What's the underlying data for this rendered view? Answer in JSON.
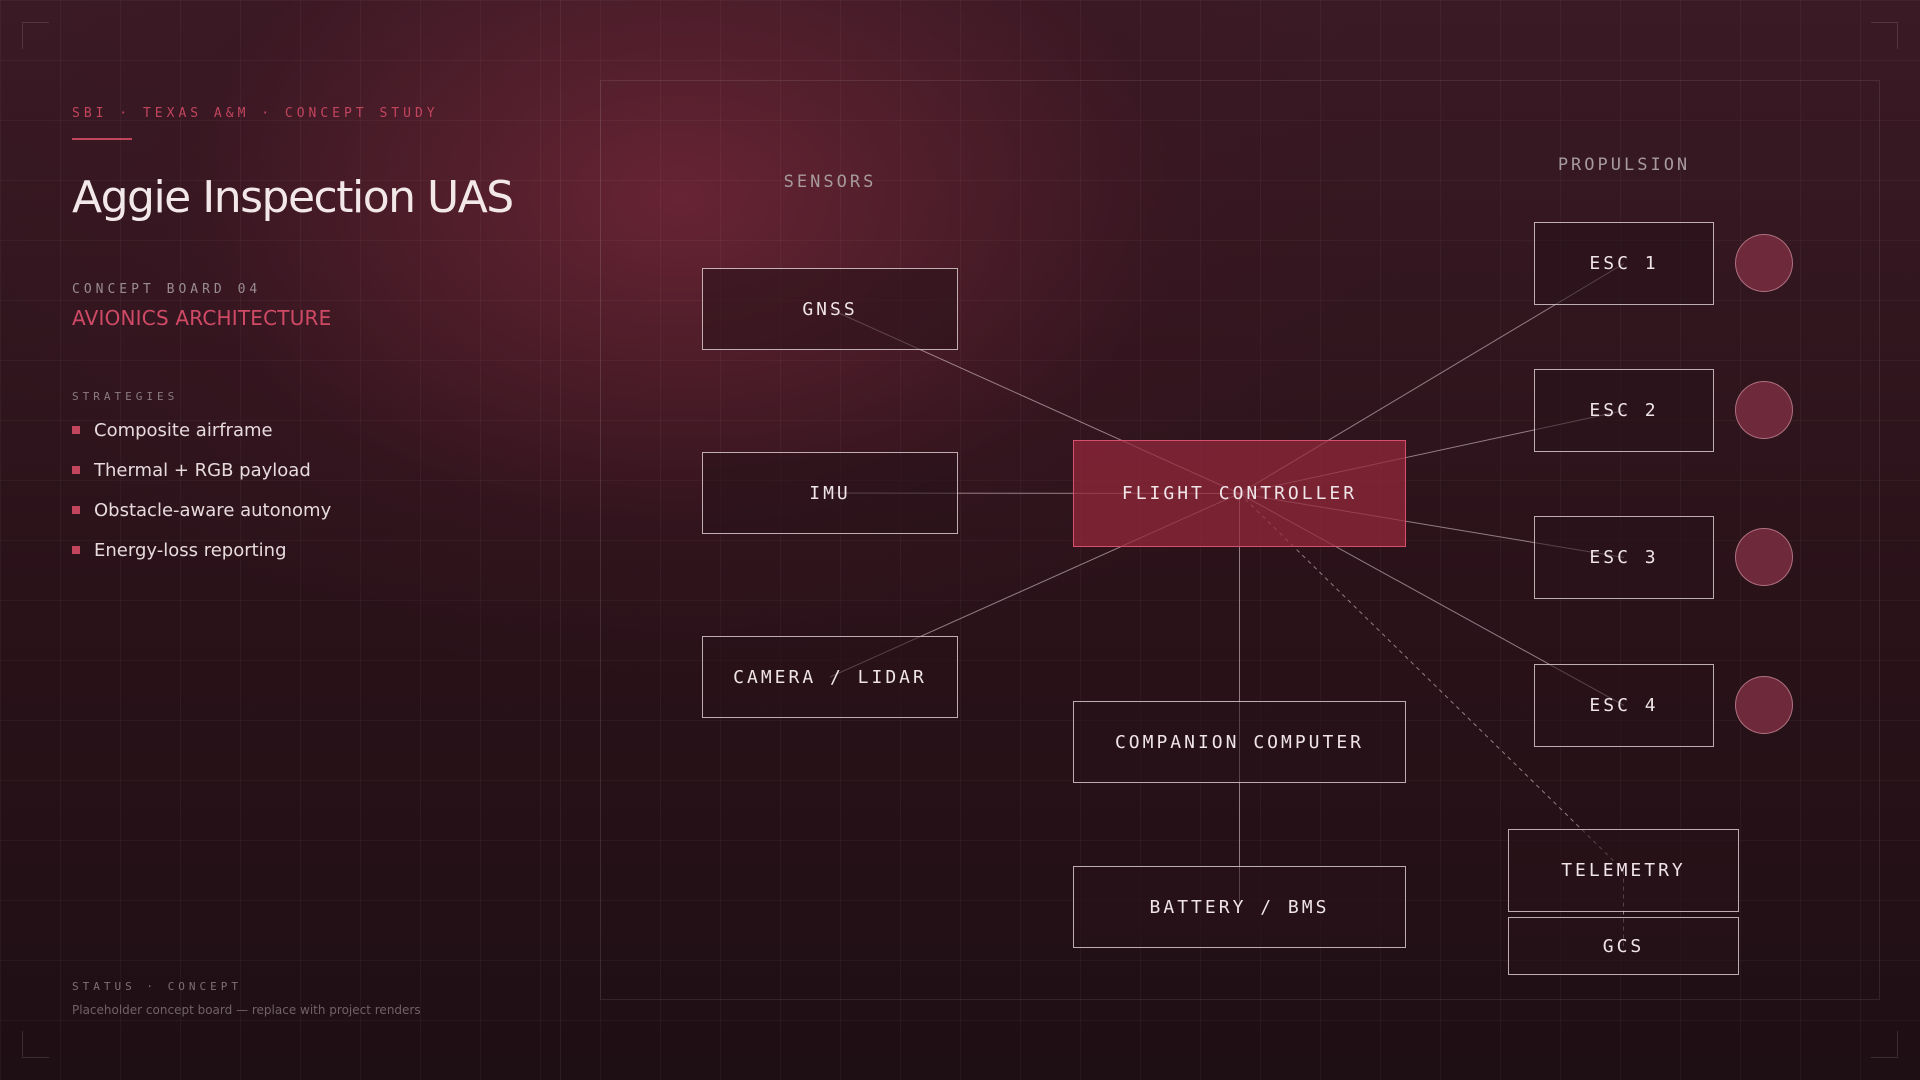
{
  "header": {
    "eyebrow": "SBI · TEXAS A&M · CONCEPT STUDY",
    "title": "Aggie Inspection UAS",
    "board_number": "CONCEPT BOARD 04",
    "board_name": "AVIONICS ARCHITECTURE"
  },
  "strategies": {
    "label": "STRATEGIES",
    "items": [
      "Composite airframe",
      "Thermal + RGB payload",
      "Obstacle-aware autonomy",
      "Energy-loss reporting"
    ]
  },
  "footer": {
    "status": "STATUS · CONCEPT",
    "note": "Placeholder concept board — replace with project renders"
  },
  "diagram": {
    "sections": {
      "sensors": "SENSORS",
      "propulsion": "PROPULSION"
    },
    "nodes": {
      "gnss": "GNSS",
      "imu": "IMU",
      "camera_lidar": "CAMERA / LIDAR",
      "flight_controller": "FLIGHT CONTROLLER",
      "companion_computer": "COMPANION COMPUTER",
      "battery_bms": "BATTERY / BMS",
      "esc_1": "ESC 1",
      "esc_2": "ESC 2",
      "esc_3": "ESC 3",
      "esc_4": "ESC 4",
      "telemetry": "TELEMETRY",
      "gcs": "GCS"
    },
    "links": [
      {
        "from": "gnss",
        "to": "flight_controller",
        "style": "solid"
      },
      {
        "from": "imu",
        "to": "flight_controller",
        "style": "solid"
      },
      {
        "from": "camera_lidar",
        "to": "flight_controller",
        "style": "solid"
      },
      {
        "from": "flight_controller",
        "to": "esc_1",
        "style": "solid"
      },
      {
        "from": "flight_controller",
        "to": "esc_2",
        "style": "solid"
      },
      {
        "from": "flight_controller",
        "to": "esc_3",
        "style": "solid"
      },
      {
        "from": "flight_controller",
        "to": "esc_4",
        "style": "solid"
      },
      {
        "from": "flight_controller",
        "to": "companion_computer",
        "style": "solid"
      },
      {
        "from": "companion_computer",
        "to": "battery_bms",
        "style": "solid"
      },
      {
        "from": "flight_controller",
        "to": "telemetry",
        "style": "dashed"
      },
      {
        "from": "telemetry",
        "to": "gcs",
        "style": "dashed"
      }
    ],
    "colors": {
      "accent": "#c2455e",
      "fc_fill": "#96283c",
      "motor": "#6e2a3a"
    }
  }
}
